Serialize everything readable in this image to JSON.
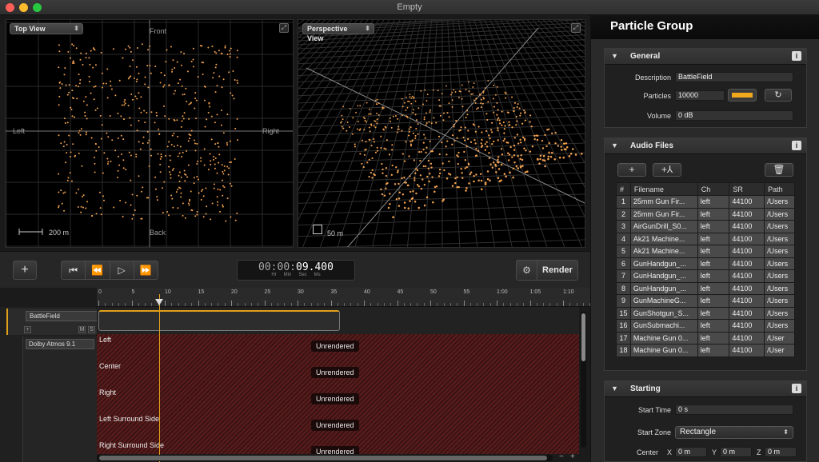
{
  "window": {
    "title": "Empty"
  },
  "top_view": {
    "selector": "Top View",
    "label_front": "Front",
    "label_back": "Back",
    "label_left": "Left",
    "label_right": "Right",
    "scale": "200 m"
  },
  "perspective_view": {
    "selector": "Perspective View",
    "scale": "50 m"
  },
  "transport": {
    "add": "+",
    "skip_back": "⏮",
    "rewind": "⏪",
    "play": "▷",
    "forward": "⏩",
    "timecode_dim": "00:00:",
    "timecode_bright": "09.400",
    "units": [
      "Hr",
      "Min",
      "Sec",
      "Ms"
    ],
    "render_label": "Render"
  },
  "timeline": {
    "ruler_labels": [
      "0",
      "5",
      "10",
      "15",
      "20",
      "25",
      "30",
      "35",
      "40",
      "45",
      "50",
      "55",
      "1:00",
      "1:05",
      "1:10"
    ],
    "group_name": "BattleField",
    "bus_name": "Dolby Atmos 9.1",
    "lanes": [
      {
        "name": "Left",
        "status": "Unrendered"
      },
      {
        "name": "Center",
        "status": "Unrendered"
      },
      {
        "name": "Right",
        "status": "Unrendered"
      },
      {
        "name": "Left Surround Side",
        "status": "Unrendered"
      },
      {
        "name": "Right Surround Side",
        "status": "Unrendered"
      }
    ]
  },
  "inspector": {
    "title": "Particle Group",
    "general": {
      "title": "General",
      "description_label": "Description",
      "description_value": "BattleField",
      "particles_label": "Particles",
      "particles_value": "10000",
      "particle_color": "#f0a81c",
      "volume_label": "Volume",
      "volume_value": "0 dB"
    },
    "audio_files": {
      "title": "Audio Files",
      "columns": [
        "#",
        "Filename",
        "Ch",
        "SR",
        "Path"
      ],
      "rows": [
        [
          "1",
          "25mm Gun Fir...",
          "left",
          "44100",
          "/Users"
        ],
        [
          "2",
          "25mm Gun Fir...",
          "left",
          "44100",
          "/Users"
        ],
        [
          "3",
          "AirGunDrill_S0...",
          "left",
          "44100",
          "/Users"
        ],
        [
          "4",
          "Ak21 Machine...",
          "left",
          "44100",
          "/Users"
        ],
        [
          "5",
          "Ak21 Machine...",
          "left",
          "44100",
          "/Users"
        ],
        [
          "6",
          "GunHandgun_...",
          "left",
          "44100",
          "/Users"
        ],
        [
          "7",
          "GunHandgun_...",
          "left",
          "44100",
          "/Users"
        ],
        [
          "8",
          "GunHandgun_...",
          "left",
          "44100",
          "/Users"
        ],
        [
          "9",
          "GunMachineG...",
          "left",
          "44100",
          "/Users"
        ],
        [
          "15",
          "GunShotgun_S...",
          "left",
          "44100",
          "/Users"
        ],
        [
          "16",
          "GunSubmachi...",
          "left",
          "44100",
          "/Users"
        ],
        [
          "17",
          "Machine Gun 0...",
          "left",
          "44100",
          "/User"
        ],
        [
          "18",
          "Machine Gun 0...",
          "left",
          "44100",
          "/User"
        ]
      ]
    },
    "starting": {
      "title": "Starting",
      "start_time_label": "Start Time",
      "start_time_value": "0 s",
      "start_zone_label": "Start Zone",
      "start_zone_value": "Rectangle",
      "center_label": "Center",
      "x_label": "X",
      "x_value": "0 m",
      "y_label": "Y",
      "y_value": "0 m",
      "z_label": "Z",
      "z_value": "0 m"
    }
  },
  "colors": {
    "accent": "#e0a01a",
    "particle": "#f0a050",
    "lane_red": "#5a1c1c"
  }
}
